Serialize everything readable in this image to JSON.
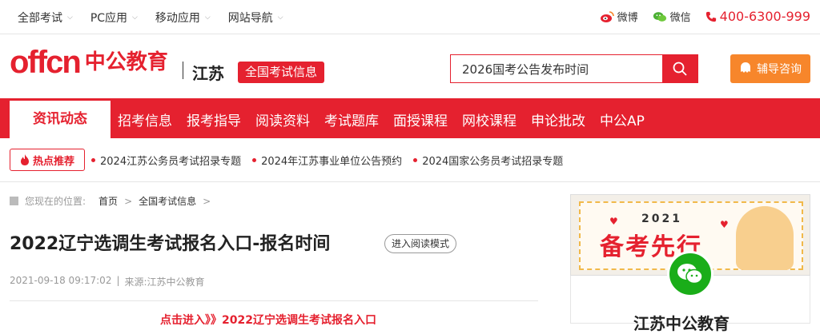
{
  "topbar": {
    "nav": [
      "全部考试",
      "PC应用",
      "移动应用",
      "网站导航"
    ],
    "weibo": "微博",
    "wechat": "微信",
    "phone": "400-6300-999"
  },
  "header": {
    "logo_latin": "offcn",
    "logo_cn": "中公教育",
    "province": "江苏",
    "exam_badge": "全国考试信息",
    "search_value": "2026国考公告发布时间",
    "consult_label": "辅导咨询"
  },
  "mainnav": {
    "active": "资讯动态",
    "items": [
      "招考信息",
      "报考指导",
      "阅读资料",
      "考试题库",
      "面授课程",
      "网校课程",
      "申论批改",
      "中公AP"
    ]
  },
  "hot": {
    "badge": "热点推荐",
    "links": [
      "2024江苏公务员考试招录专题",
      "2024年江苏事业单位公告预约",
      "2024国家公务员考试招录专题"
    ]
  },
  "breadcrumb": {
    "prefix": "您现在的位置:",
    "home": "首页",
    "section": "全国考试信息"
  },
  "article": {
    "title": "2022辽宁选调生考试报名入口-报名时间",
    "read_mode": "进入阅读模式",
    "date": "2021-09-18 09:17:02",
    "source": "来源:江苏中公教育",
    "subline": "点击进入》》2022辽宁选调生考试报名入口"
  },
  "sidebar": {
    "banner_year": "2021",
    "banner_slogan": "备考先行",
    "name": "江苏中公教育"
  },
  "colors": {
    "brand_red": "#e5212f",
    "orange": "#f7862b",
    "wechat_green": "#1aad19"
  }
}
